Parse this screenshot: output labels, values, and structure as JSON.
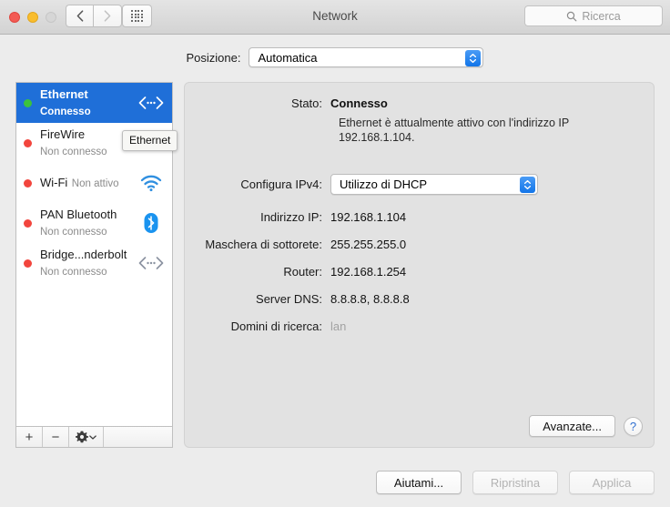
{
  "window": {
    "title": "Network",
    "traffic_lights": [
      "close",
      "minimize",
      "zoom"
    ]
  },
  "toolbar": {
    "back_icon": "chevron-left-icon",
    "forward_icon": "chevron-right-icon",
    "show_all_icon": "grid-icon",
    "search": {
      "placeholder": "Ricerca",
      "value": "",
      "icon": "search-icon"
    }
  },
  "location": {
    "label": "Posizione:",
    "selected": "Automatica"
  },
  "sidebar": {
    "services": [
      {
        "name": "Ethernet",
        "state": "Connesso",
        "status": "green",
        "icon": "ethernet-icon",
        "selected": true
      },
      {
        "name": "FireWire",
        "state": "Non connesso",
        "status": "red",
        "icon": "firewire-icon",
        "selected": false
      },
      {
        "name": "Wi-Fi",
        "state": "Non attivo",
        "status": "red",
        "icon": "wifi-icon",
        "selected": false
      },
      {
        "name": "PAN Bluetooth",
        "state": "Non connesso",
        "status": "red",
        "icon": "bluetooth-icon",
        "selected": false
      },
      {
        "name": "Bridge...nderbolt",
        "state": "Non connesso",
        "status": "red",
        "icon": "thunderbolt-bridge-icon",
        "selected": false
      }
    ],
    "toolbar": {
      "add": "+",
      "remove": "−",
      "gear_icon": "gear-icon",
      "gear_chevron": "chevron-down-icon"
    },
    "tooltip": "Ethernet"
  },
  "detail": {
    "stato_label": "Stato:",
    "stato_value": "Connesso",
    "stato_description": "Ethernet è attualmente attivo con l'indirizzo IP 192.168.1.104.",
    "configura_label": "Configura IPv4:",
    "configura_value": "Utilizzo di DHCP",
    "indirizzo_label": "Indirizzo IP:",
    "indirizzo_value": "192.168.1.104",
    "maschera_label": "Maschera di sottorete:",
    "maschera_value": "255.255.255.0",
    "router_label": "Router:",
    "router_value": "192.168.1.254",
    "dns_label": "Server DNS:",
    "dns_value": "8.8.8.8, 8.8.8.8",
    "domini_label": "Domini di ricerca:",
    "domini_value": "lan",
    "advanced_button": "Avanzate...",
    "help_button": "?"
  },
  "footer": {
    "help_me": "Aiutami...",
    "revert": "Ripristina",
    "apply": "Applica"
  },
  "colors": {
    "accent": "#1f6fd8",
    "stepper_blue": "#1275e8",
    "status_connected": "#3cc23c",
    "status_disconnected": "#f2453d",
    "window_bg": "#ececec",
    "panel_bg": "#e2e2e2",
    "help_blue": "#2f6fd0"
  }
}
